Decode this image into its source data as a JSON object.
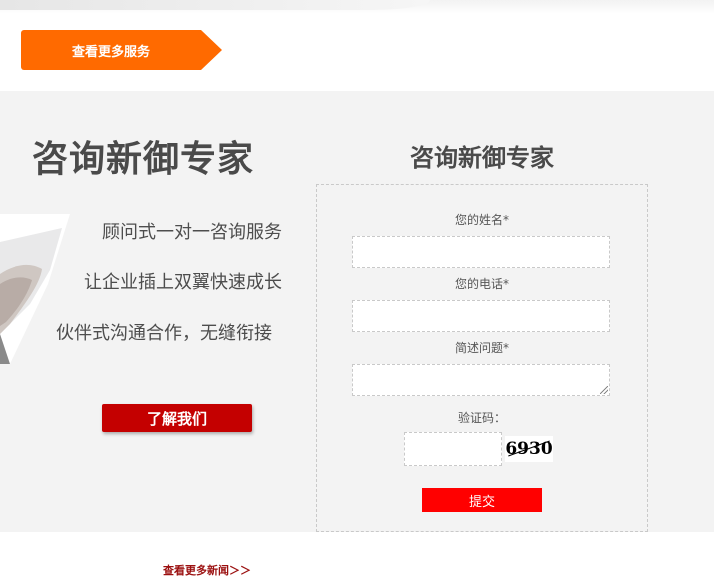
{
  "header": {
    "more_services_label": "查看更多服务"
  },
  "left": {
    "title": "咨询新御专家",
    "bullets": [
      "顾问式一对一咨询服务",
      "让企业插上双翼快速成长",
      "伙伴式沟通合作，无缝衔接"
    ],
    "about_button_label": "了解我们"
  },
  "form": {
    "title": "咨询新御专家",
    "name_label": "您的姓名*",
    "name_value": "",
    "phone_label": "您的电话*",
    "phone_value": "",
    "question_label": "简述问题*",
    "question_value": "",
    "captcha_label": "验证码：",
    "captcha_value": "",
    "captcha_code": "6930",
    "submit_label": "提交"
  },
  "footer": {
    "more_news_label": "查看更多新闻＞＞"
  }
}
